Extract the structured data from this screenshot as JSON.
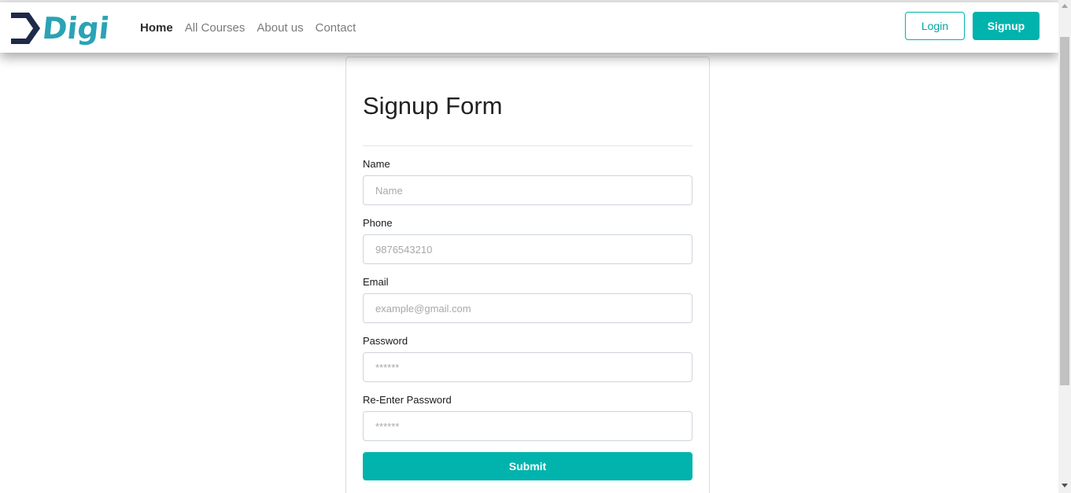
{
  "brand": {
    "name": "Digi",
    "colors": {
      "dark": "#1f2a4a",
      "accent": "#2aa3b5"
    }
  },
  "nav": {
    "links": [
      {
        "label": "Home",
        "active": true
      },
      {
        "label": "All Courses",
        "active": false
      },
      {
        "label": "About us",
        "active": false
      },
      {
        "label": "Contact",
        "active": false
      }
    ]
  },
  "auth": {
    "login_label": "Login",
    "signup_label": "Signup"
  },
  "form": {
    "title": "Signup Form",
    "fields": [
      {
        "label": "Name",
        "placeholder": "Name",
        "type": "text"
      },
      {
        "label": "Phone",
        "placeholder": "9876543210",
        "type": "tel"
      },
      {
        "label": "Email",
        "placeholder": "example@gmail.com",
        "type": "email"
      },
      {
        "label": "Password",
        "placeholder": "******",
        "type": "password"
      },
      {
        "label": "Re-Enter Password",
        "placeholder": "******",
        "type": "password"
      }
    ],
    "submit_label": "Submit"
  },
  "colors": {
    "primary": "#00b3ad",
    "border": "#ced4da"
  }
}
